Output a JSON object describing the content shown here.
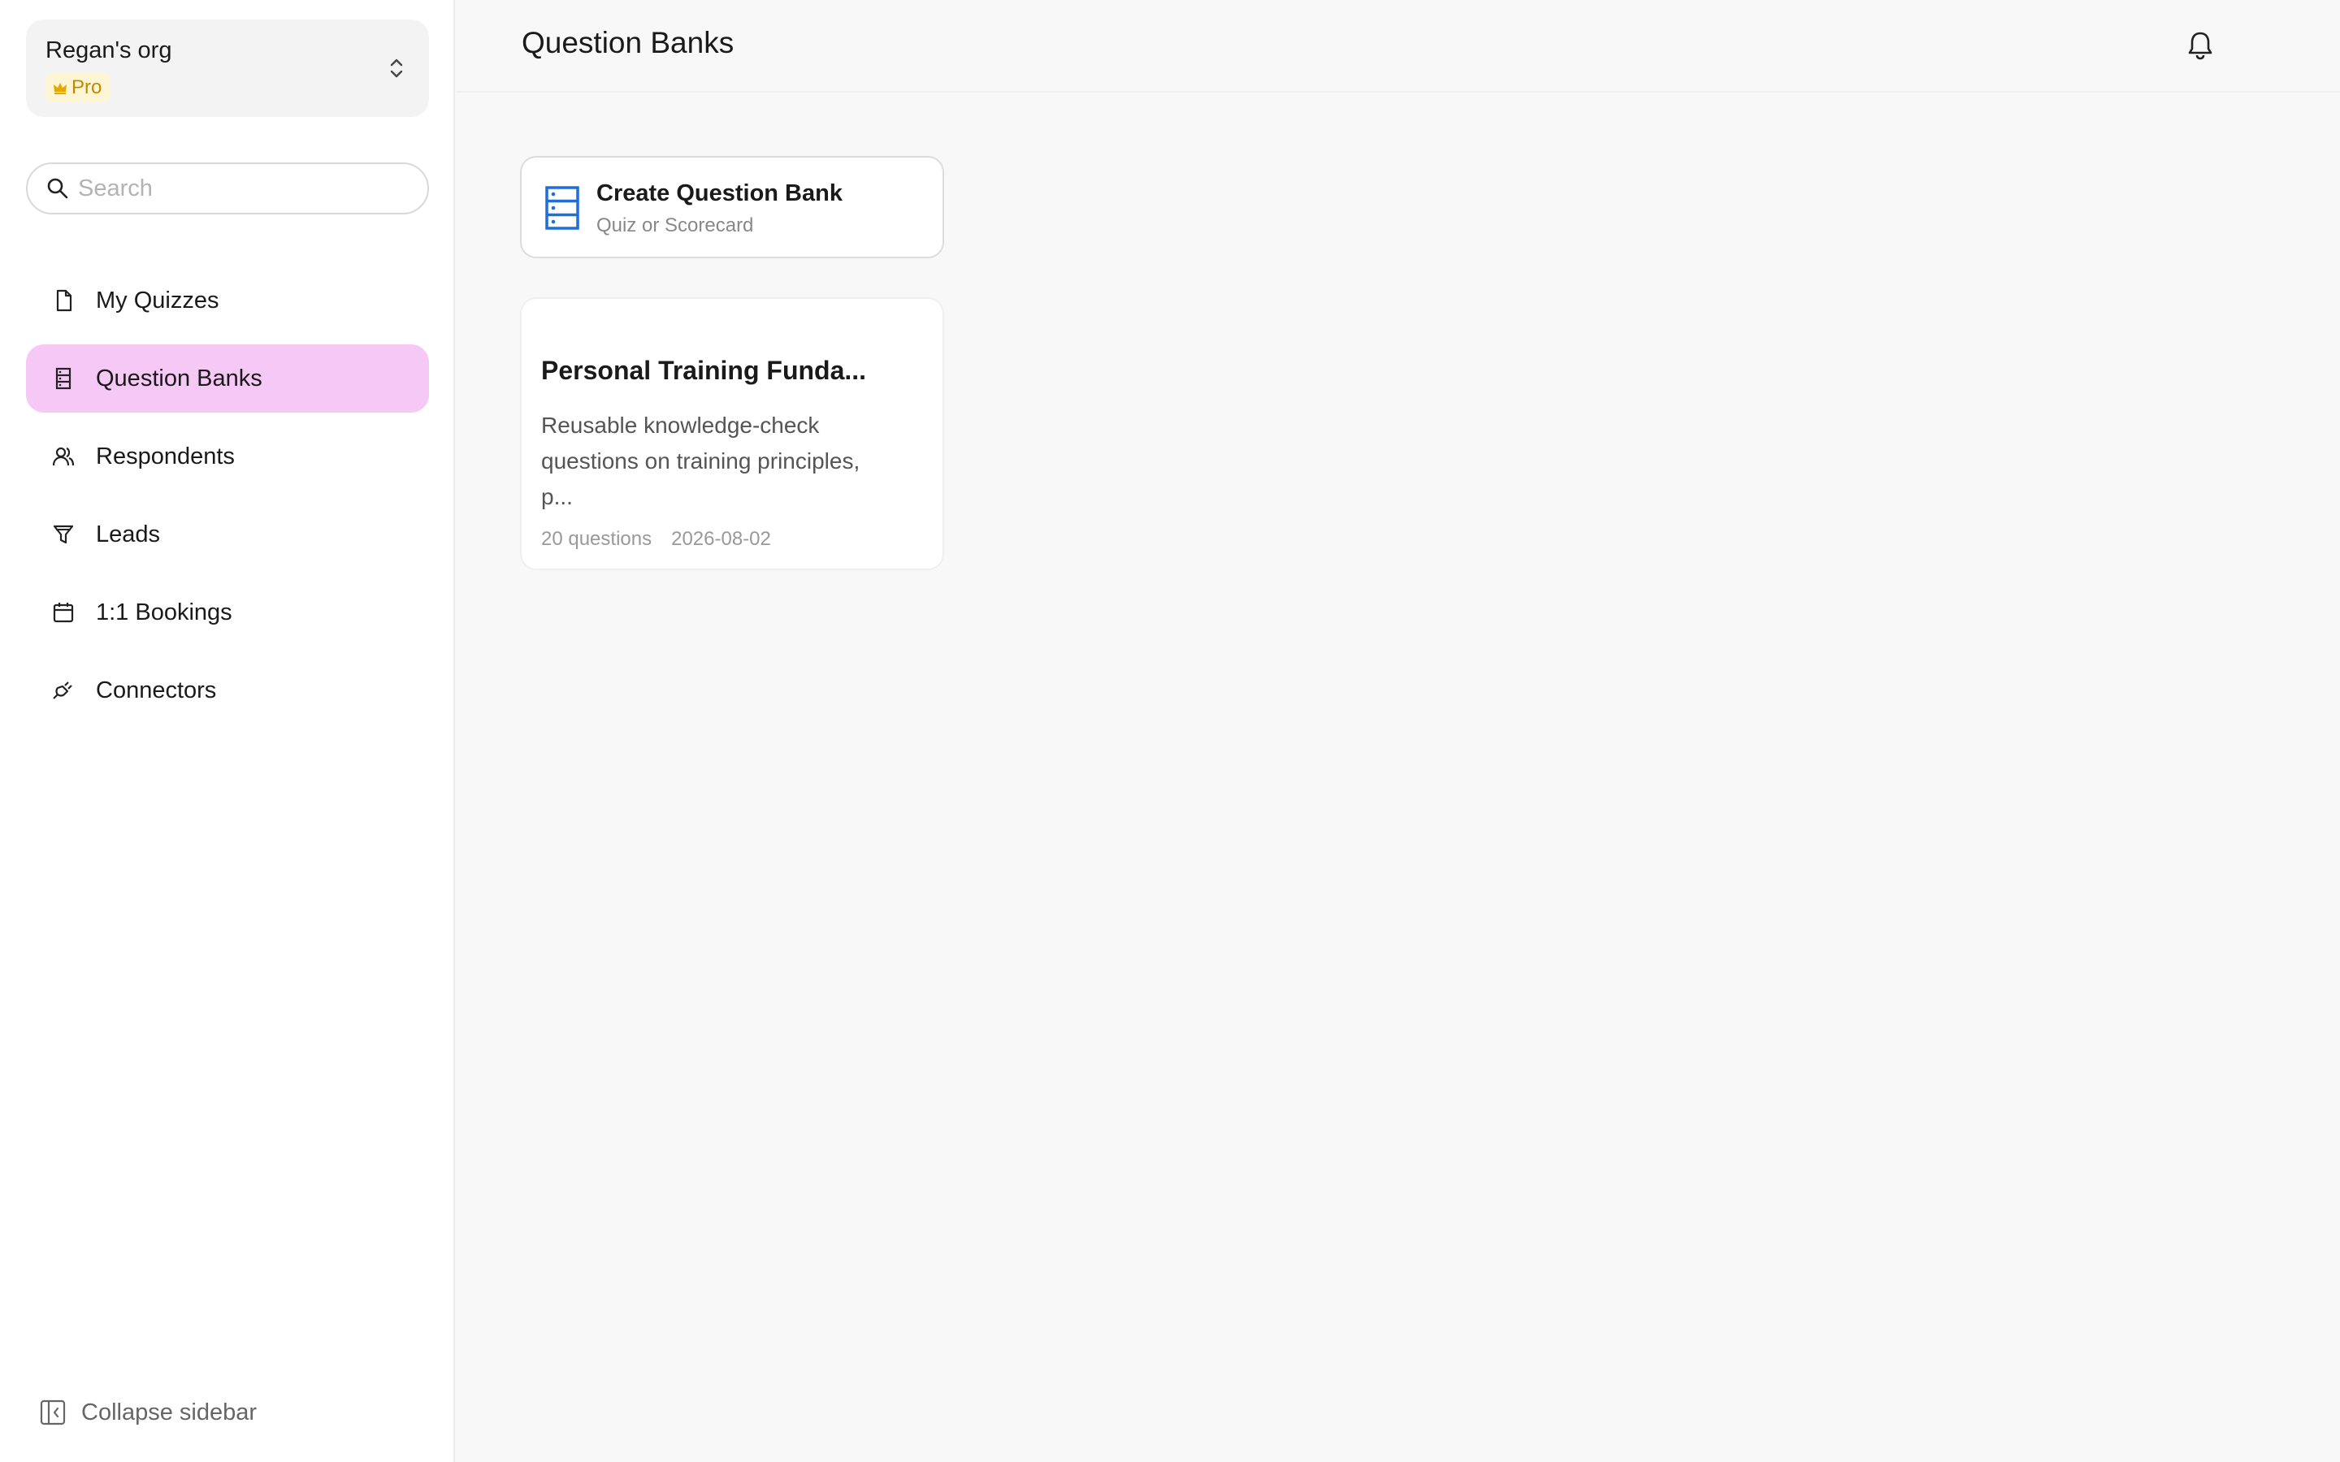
{
  "sidebar": {
    "org": {
      "name": "Regan's org",
      "plan": "Pro"
    },
    "search": {
      "placeholder": "Search"
    },
    "items": [
      {
        "label": "My Quizzes",
        "icon": "file-icon"
      },
      {
        "label": "Question Banks",
        "icon": "question-bank-icon",
        "active": true
      },
      {
        "label": "Respondents",
        "icon": "users-icon"
      },
      {
        "label": "Leads",
        "icon": "funnel-icon"
      },
      {
        "label": "1:1 Bookings",
        "icon": "calendar-icon"
      },
      {
        "label": "Connectors",
        "icon": "plug-icon"
      }
    ],
    "collapse_label": "Collapse sidebar"
  },
  "header": {
    "title": "Question Banks"
  },
  "create_card": {
    "title": "Create Question Bank",
    "subtitle": "Quiz or Scorecard"
  },
  "banks": [
    {
      "title": "Personal Training Funda...",
      "description": "Reusable knowledge-check questions on training principles, p...",
      "question_count": "20 questions",
      "date": "2026-08-02"
    }
  ],
  "colors": {
    "active_nav": "#f5c8f5",
    "pro_badge_bg": "#fdf5d3",
    "pro_badge_text": "#c08a00",
    "accent_blue": "#1f6fd6",
    "background": "#f8f8f8"
  }
}
